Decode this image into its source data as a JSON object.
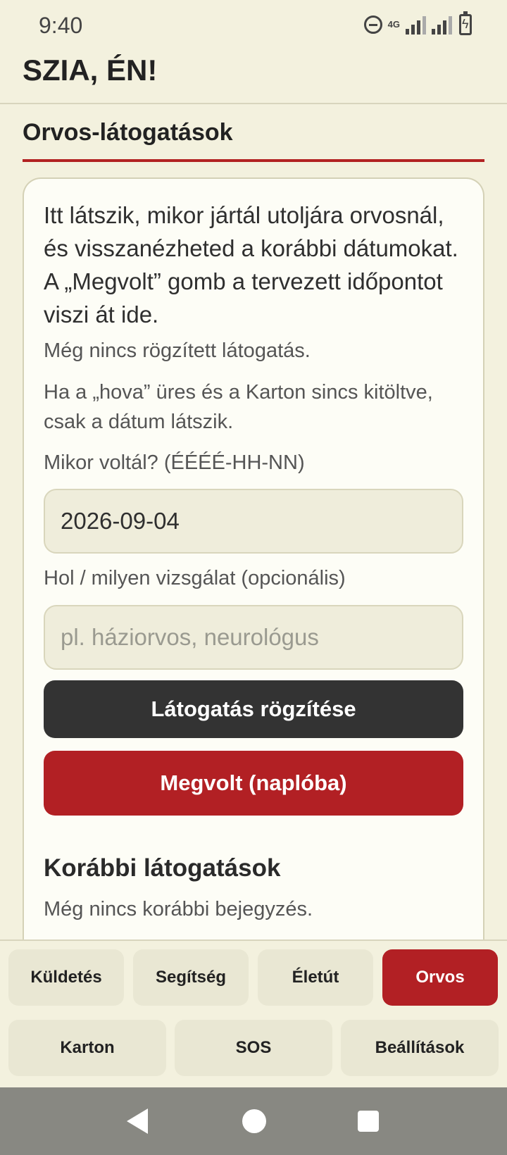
{
  "status_bar": {
    "time": "9:40",
    "network": "4G"
  },
  "header": {
    "title": "SZIA, ÉN!"
  },
  "section": {
    "title": "Orvos-látogatások"
  },
  "card": {
    "intro": "Itt látszik, mikor jártál utoljára orvosnál, és visszanézheted a korábbi dátumokat. A „Megvolt” gomb a tervezett időpontot viszi át ide.",
    "no_visit": "Még nincs rögzített látogatás.",
    "hint": "Ha a „hova” üres és a Karton sincs kitöltve, csak a dátum látszik.",
    "date_label": "Mikor voltál? (ÉÉÉÉ-HH-NN)",
    "date_value": "2026-09-04",
    "place_label": "Hol / milyen vizsgálat (opcionális)",
    "place_placeholder": "pl. háziorvos, neurológus",
    "record_button": "Látogatás rögzítése",
    "done_button": "Megvolt (naplóba)",
    "history_title": "Korábbi látogatások",
    "history_empty": "Még nincs korábbi bejegyzés."
  },
  "tabs": {
    "row1": [
      "Küldetés",
      "Segítség",
      "Életút",
      "Orvos"
    ],
    "row2": [
      "Karton",
      "SOS",
      "Beállítások"
    ],
    "active": "Orvos"
  },
  "colors": {
    "accent": "#b22024",
    "background": "#f3f1de",
    "dark_button": "#333333"
  },
  "icons": [
    "dnd-icon",
    "signal-icon",
    "battery-icon",
    "back-icon",
    "home-icon",
    "recent-apps-icon"
  ]
}
